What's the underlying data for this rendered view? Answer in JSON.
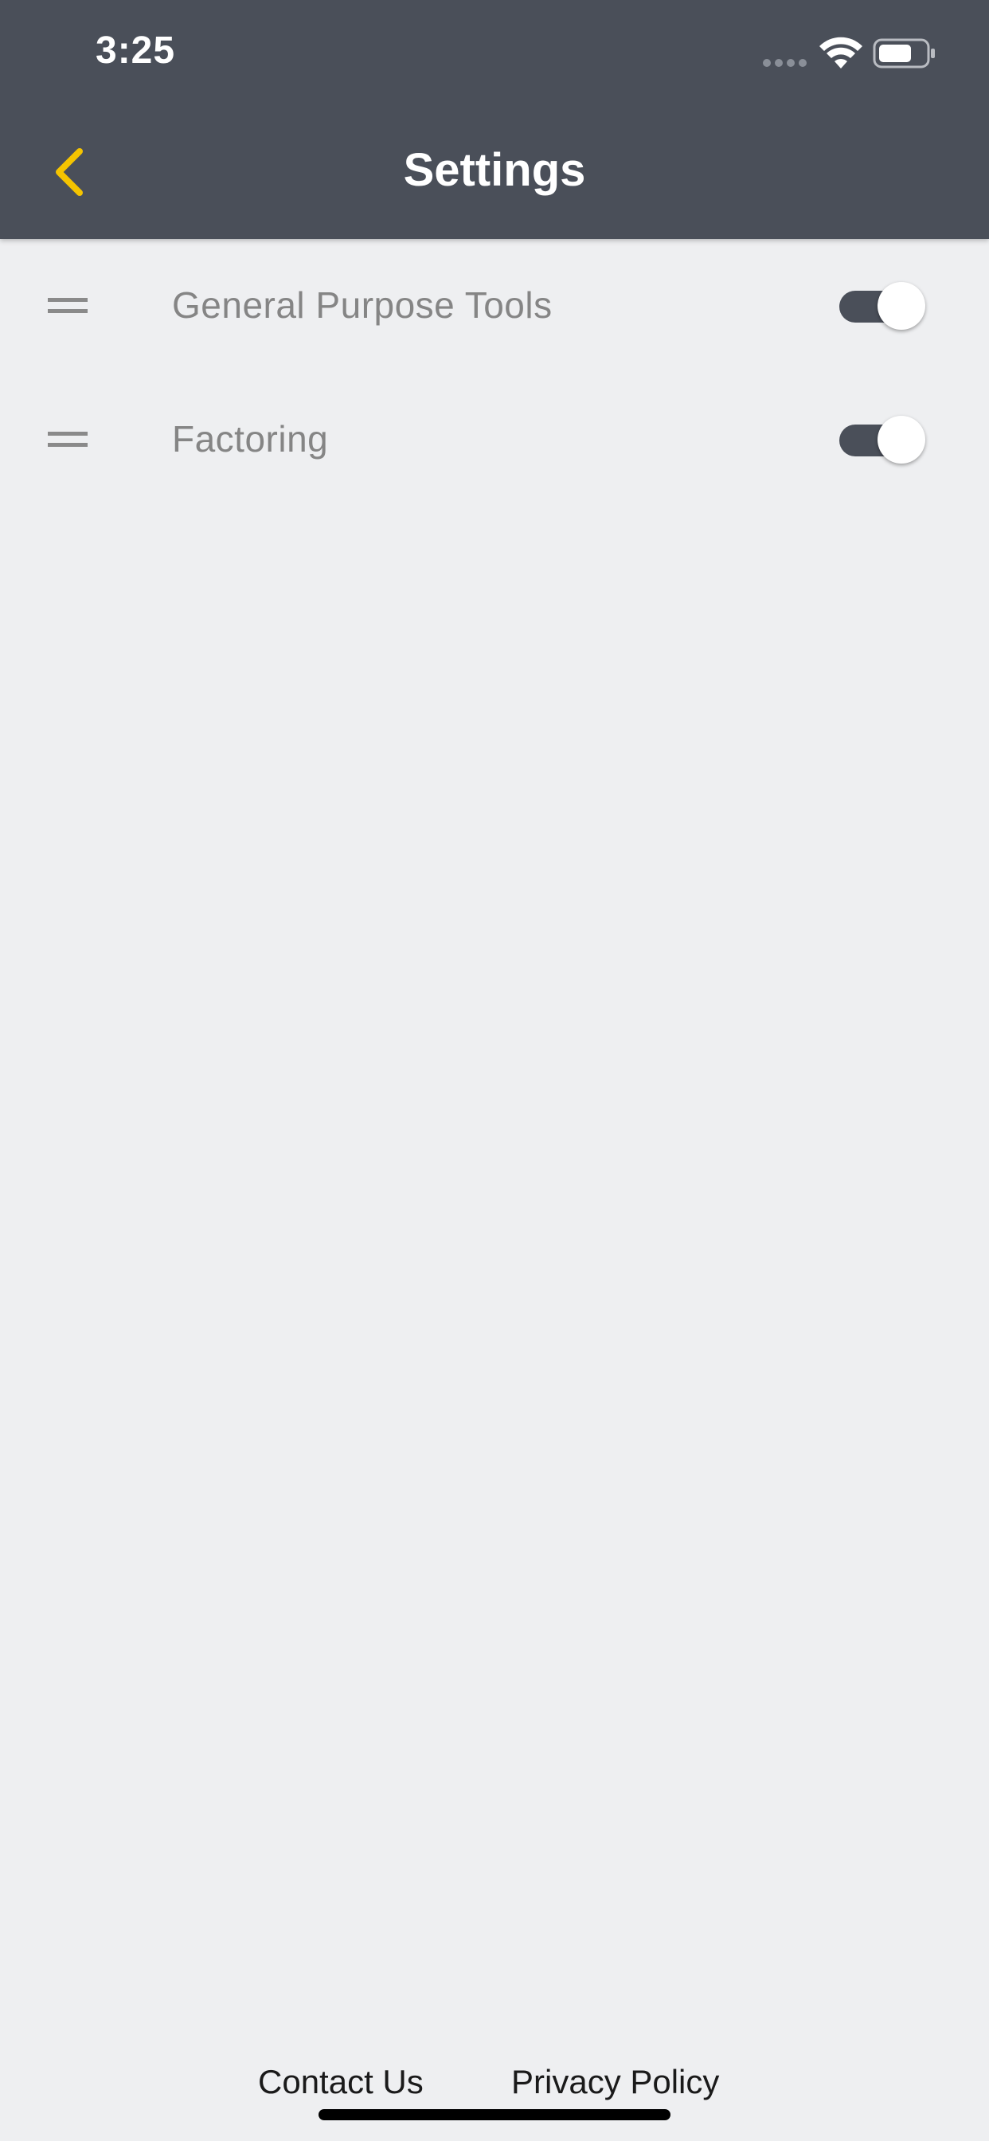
{
  "status_bar": {
    "time": "3:25",
    "wifi_icon": "wifi-icon",
    "battery_icon": "battery-icon"
  },
  "header": {
    "title": "Settings",
    "back_icon": "chevron-left-icon",
    "accent_color": "#f5c400",
    "background_color": "#4a4f59"
  },
  "settings_items": [
    {
      "label": "General Purpose Tools",
      "enabled": true
    },
    {
      "label": "Factoring",
      "enabled": true
    }
  ],
  "footer": {
    "contact_label": "Contact Us",
    "privacy_label": "Privacy Policy"
  }
}
